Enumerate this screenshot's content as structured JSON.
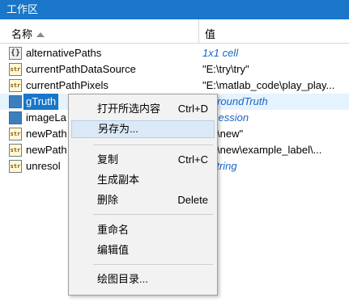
{
  "window": {
    "title": "工作区"
  },
  "header": {
    "name_label": "名称",
    "value_label": "值"
  },
  "rows": [
    {
      "icon": "{}",
      "name": "alternativePaths",
      "value": "1x1 cell"
    },
    {
      "icon": "str",
      "name": "currentPathDataSource",
      "value": "\"E:\\try\\try\""
    },
    {
      "icon": "str",
      "name": "currentPathPixels",
      "value": "\"E:\\matlab_code\\play_play..."
    },
    {
      "icon": "obj",
      "name": "gTruth",
      "value": "1 groundTruth"
    },
    {
      "icon": "obj",
      "name": "imageLa",
      "value": "1 Session"
    },
    {
      "icon": "str",
      "name": "newPath",
      "value": "\\try\\new\""
    },
    {
      "icon": "str",
      "name": "newPath",
      "value": "\\try\\new\\example_label\\..."
    },
    {
      "icon": "str",
      "name": "unresol",
      "value": "0 string"
    }
  ],
  "context_menu": {
    "items": [
      {
        "label": "打开所选内容",
        "shortcut": "Ctrl+D"
      },
      {
        "label": "另存为..."
      },
      {
        "label": "复制",
        "shortcut": "Ctrl+C"
      },
      {
        "label": "生成副本"
      },
      {
        "label": "删除",
        "shortcut": "Delete"
      },
      {
        "label": "重命名"
      },
      {
        "label": "编辑值"
      },
      {
        "label": "绘图目录..."
      }
    ]
  }
}
